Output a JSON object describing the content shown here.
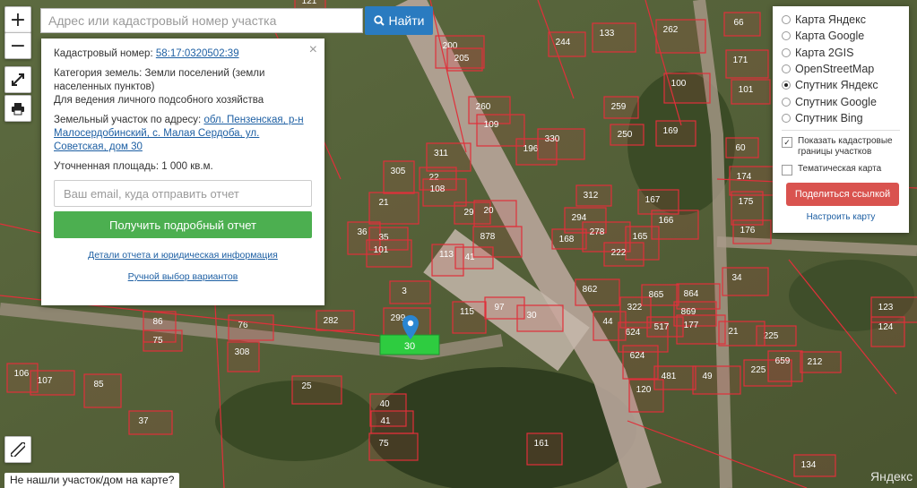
{
  "search": {
    "placeholder": "Адрес или кадастровый номер участка",
    "button_label": "Найти"
  },
  "controls": {
    "zoom_in": "+",
    "zoom_out": "−"
  },
  "info_panel": {
    "cadastral_label": "Кадастровый номер:",
    "cadastral_number": "58:17:0320502:39",
    "category_label": "Категория земель:",
    "category_value": "Земли поселений (земли населенных пунктов)",
    "usage": "Для ведения личного подсобного хозяйства",
    "address_label": "Земельный участок по адресу:",
    "address_value": "обл. Пензенская, р-н Малосердобинский, с. Малая Сердоба, ул. Советская, дом 30",
    "area_label": "Уточненная площадь:",
    "area_value": "1 000 кв.м.",
    "email_placeholder": "Ваш email, куда отправить отчет",
    "report_button": "Получить подробный отчет",
    "details_link": "Детали отчета и юридическая информация",
    "manual_link": "Ручной выбор вариантов",
    "close": "×"
  },
  "layers_panel": {
    "options": [
      {
        "label": "Карта Яндекс",
        "selected": false
      },
      {
        "label": "Карта Google",
        "selected": false
      },
      {
        "label": "Карта 2GIS",
        "selected": false
      },
      {
        "label": "OpenStreetMap",
        "selected": false
      },
      {
        "label": "Спутник Яндекс",
        "selected": true
      },
      {
        "label": "Спутник Google",
        "selected": false
      },
      {
        "label": "Спутник Bing",
        "selected": false
      }
    ],
    "show_cadastral": "Показать кадастровые границы участков",
    "show_cadastral_checked": "✓",
    "thematic_map": "Тематическая карта",
    "share_button": "Поделиться ссылкой",
    "setup_link": "Настроить карту"
  },
  "bottom": {
    "not_found": "Не нашли участок/дом на карте?",
    "provider": "Яндекс"
  },
  "map": {
    "selected_parcel_label": "30",
    "parcel_numbers": [
      "121",
      "244",
      "133",
      "262",
      "66",
      "171",
      "200",
      "205",
      "260",
      "109",
      "259",
      "196",
      "330",
      "250",
      "169",
      "100",
      "60",
      "101",
      "174",
      "175",
      "176",
      "311",
      "305",
      "22",
      "108",
      "21",
      "29",
      "20",
      "878",
      "312",
      "294",
      "278",
      "168",
      "167",
      "166",
      "165",
      "222",
      "34",
      "36",
      "35",
      "101",
      "113",
      "41",
      "862",
      "322",
      "865",
      "864",
      "624",
      "517",
      "869",
      "177",
      "624",
      "481",
      "49",
      "120",
      "3",
      "299",
      "115",
      "97",
      "30",
      "86",
      "75",
      "76",
      "308",
      "282",
      "107",
      "106",
      "85",
      "37",
      "25",
      "40",
      "41",
      "75",
      "161",
      "134",
      "225",
      "659",
      "212",
      "123",
      "124",
      "225",
      "21",
      "44"
    ],
    "colors": {
      "parcel_stroke": "#e0303a",
      "parcel_fill": "rgba(230,60,70,0.12)",
      "selected_fill": "#2ecc40",
      "pin": "#2a86d1"
    }
  }
}
